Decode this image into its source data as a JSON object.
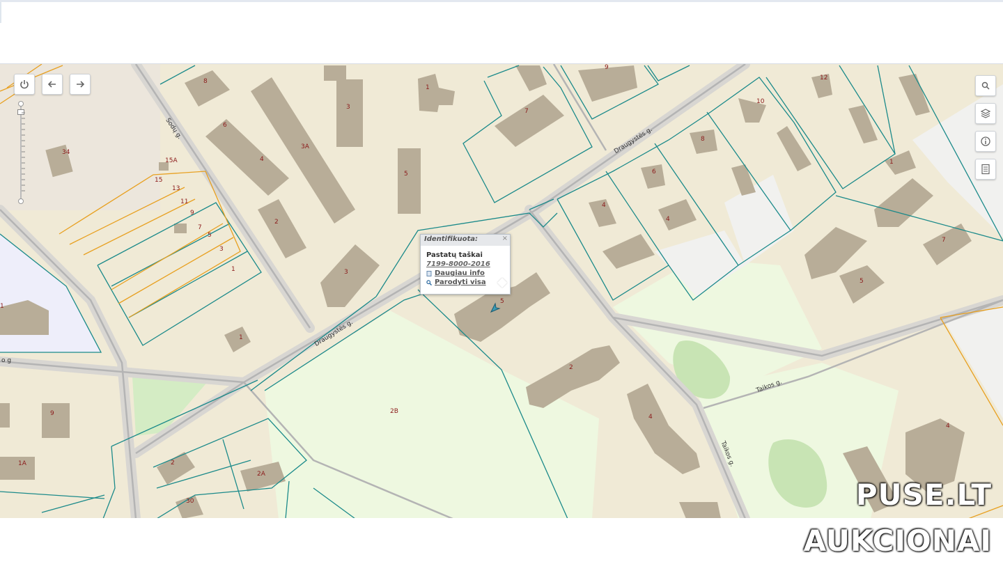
{
  "toolbar": {
    "power_icon": "power-icon",
    "back_icon": "arrow-left-icon",
    "forward_icon": "arrow-right-icon",
    "right_tools": [
      "search-icon",
      "layers-icon",
      "info-icon",
      "document-list-icon"
    ]
  },
  "map": {
    "street_labels": {
      "sodu": "Sodų g.",
      "draugystes_upper": "Draugystės g.",
      "draugystes_lower": "Draugystės g.",
      "taikos_h": "Taikos g.",
      "taikos_v": "Taikos g.",
      "left_edge": "o g"
    },
    "house_numbers": [
      "8",
      "1",
      "3",
      "6",
      "3A",
      "4",
      "5",
      "7",
      "9",
      "10",
      "12",
      "34",
      "15A",
      "15",
      "13",
      "11",
      "9",
      "7",
      "5",
      "3",
      "1",
      "2",
      "3",
      "1",
      "4",
      "6",
      "4",
      "8",
      "5",
      "1",
      "1",
      "7",
      "5",
      "2B",
      "2",
      "4",
      "4",
      "2",
      "2A",
      "30",
      "1A",
      "9",
      "4"
    ]
  },
  "popup": {
    "header": "Identifikuota:",
    "close": "×",
    "title": "Pastatų taškai",
    "code": "7199-8000-2016",
    "more_info": "Daugiau info",
    "show_all": "Parodyti visa"
  },
  "watermark": {
    "line1": "PUSE.LT",
    "line2": "AUKCIONAI"
  },
  "colors": {
    "land": "#f0ead6",
    "building": "#b8ad98",
    "parcel_teal": "#1b8a8a",
    "parcel_orange": "#e8a020",
    "green_area": "#eef8e0",
    "park": "#c8e4b4",
    "road": "#b4b4b4"
  }
}
